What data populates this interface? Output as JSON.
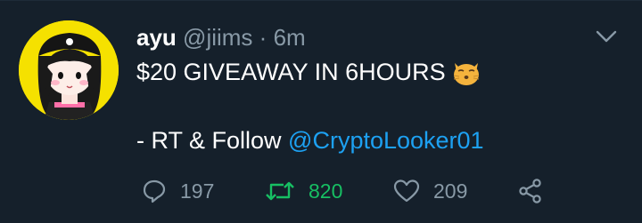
{
  "tweet": {
    "display_name": "ayu",
    "handle": "@jiims",
    "separator": "·",
    "time": "6m",
    "line1": "$20 GIVEAWAY IN 6HOURS",
    "line1_emoji": "kissing-cat-emoji",
    "line2_prefix": "- RT & Follow ",
    "mention": "@CryptoLooker01"
  },
  "actions": {
    "replies": "197",
    "retweets": "820",
    "likes": "209"
  },
  "colors": {
    "background": "#15202b",
    "text": "#ffffff",
    "secondary": "#8899a6",
    "link": "#1da1f2",
    "retweet_active": "#17bf63",
    "avatar_bg": "#f5e100"
  },
  "icons": {
    "reply": "reply-icon",
    "retweet": "retweet-icon",
    "like": "heart-icon",
    "share": "share-icon",
    "more": "chevron-down-icon"
  }
}
